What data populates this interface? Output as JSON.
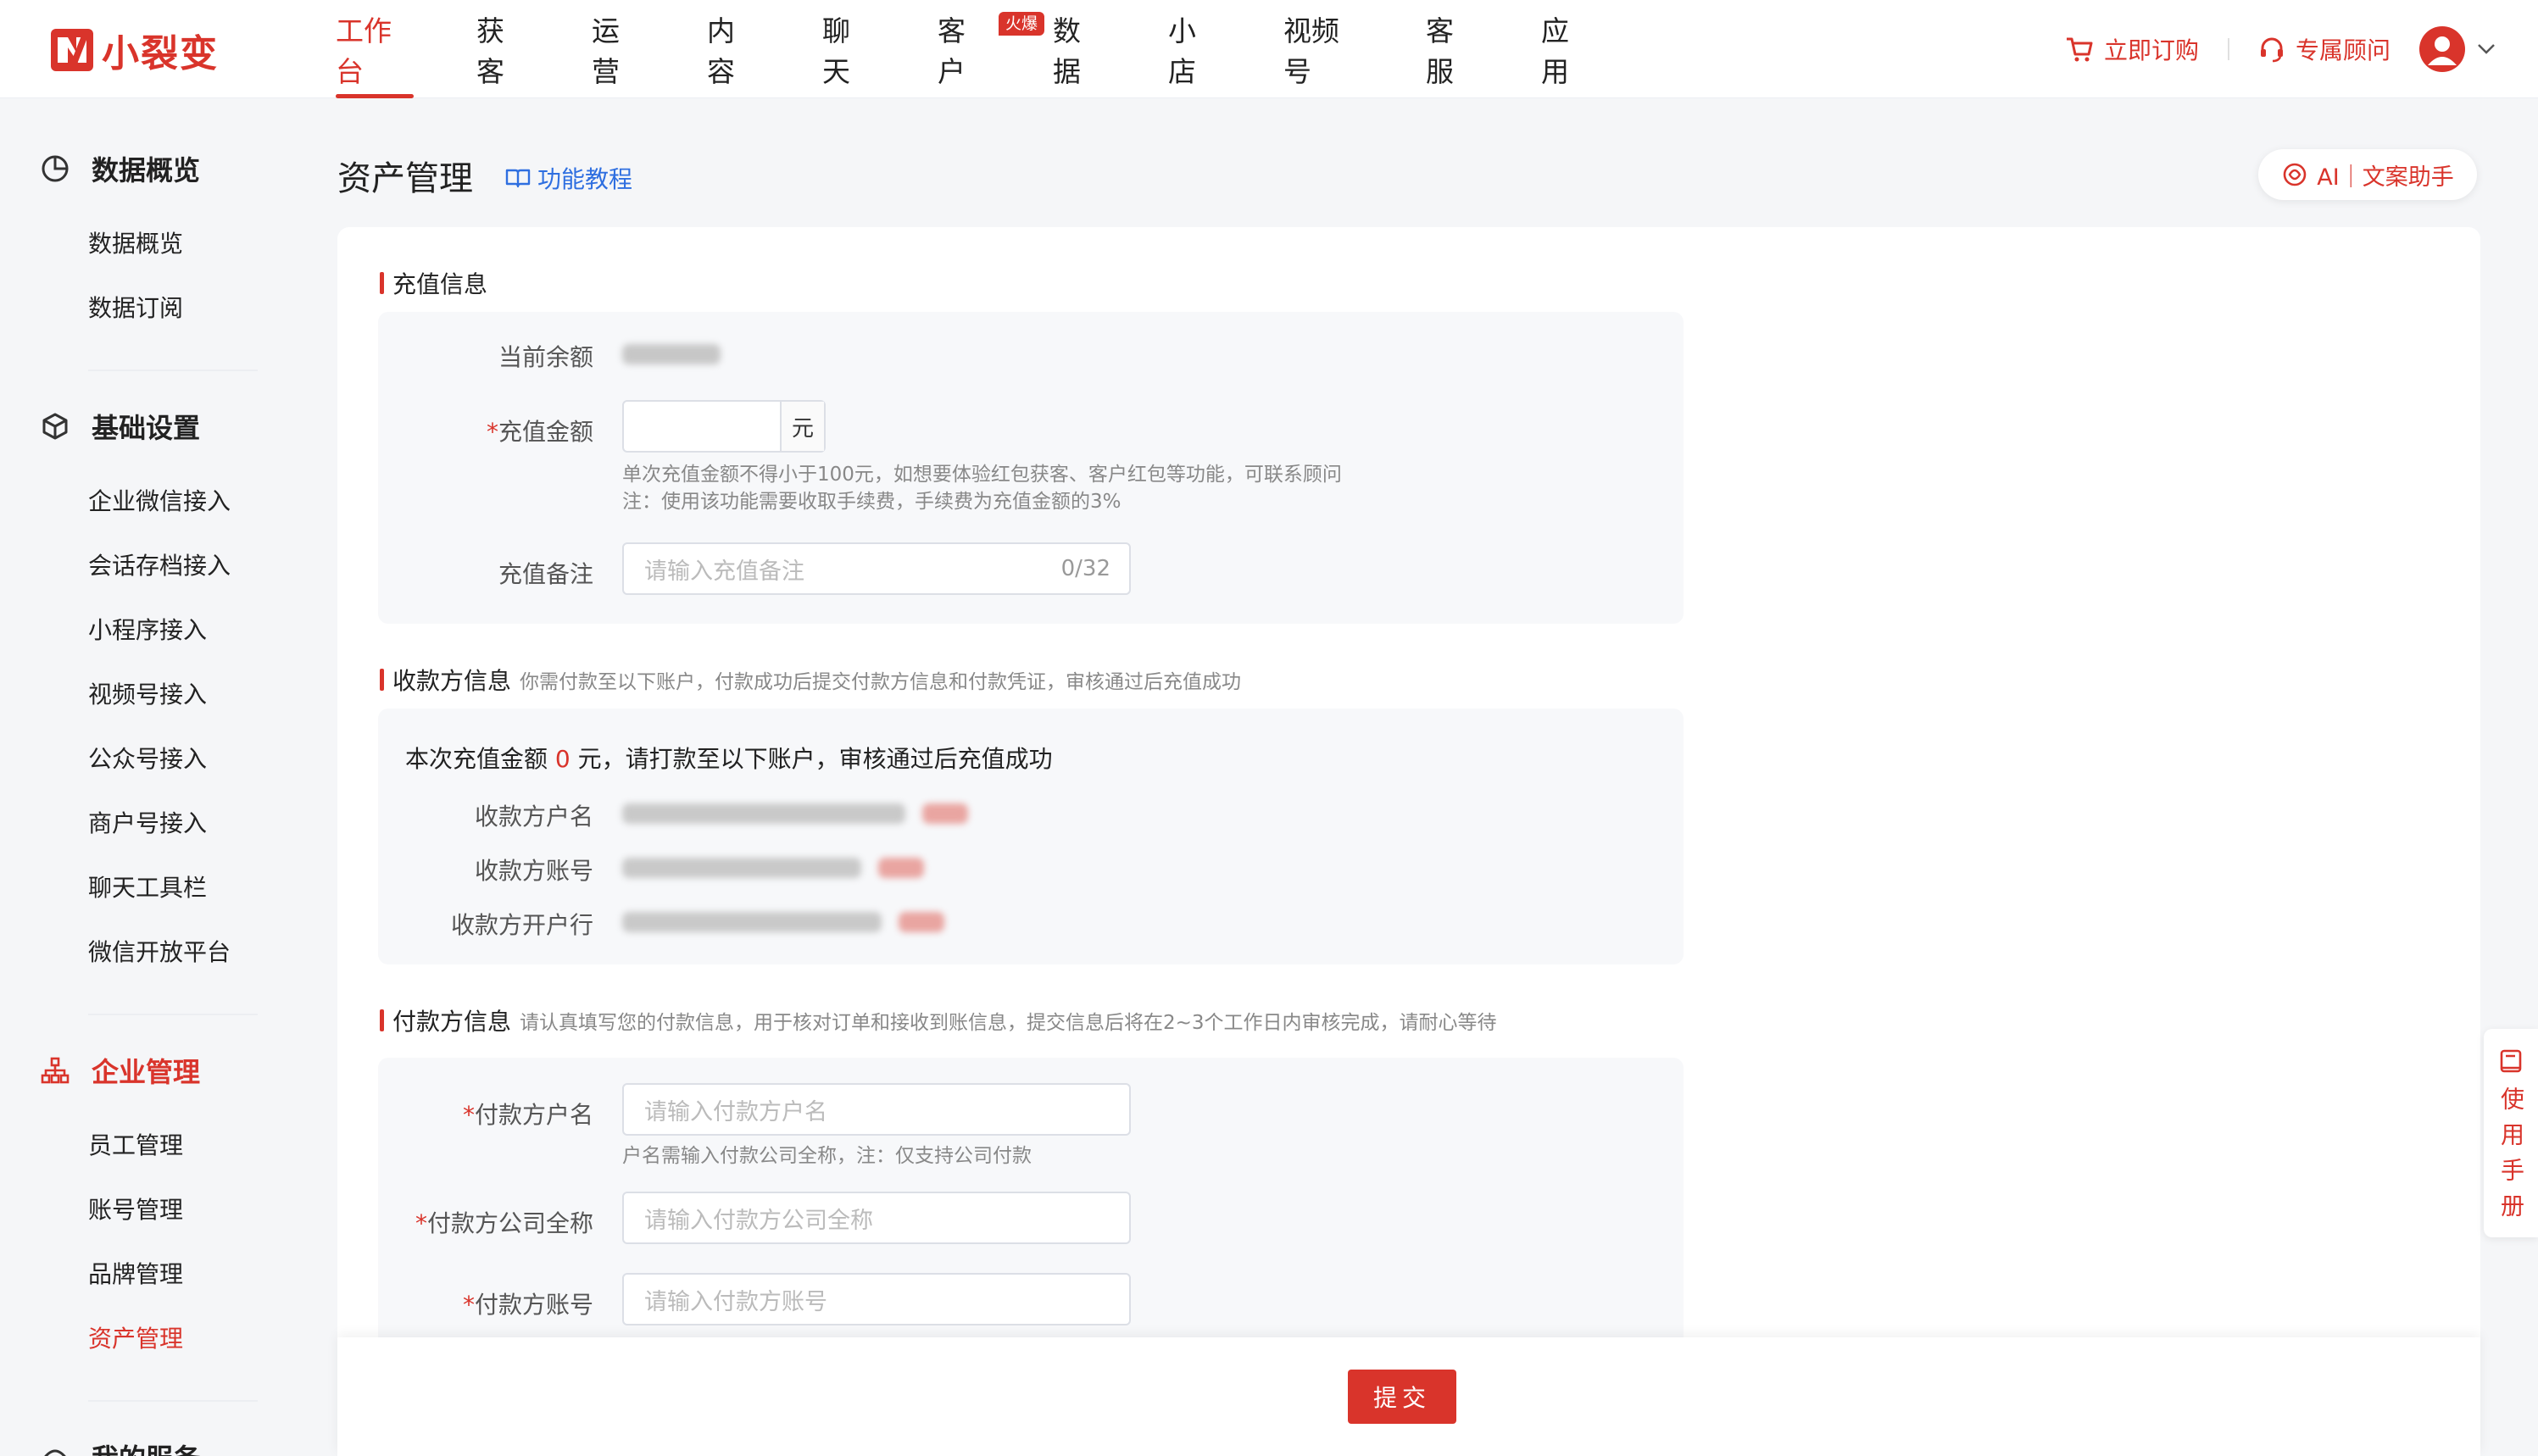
{
  "brand": {
    "name": "小裂变",
    "color": "#d9342b"
  },
  "nav": {
    "items": [
      "工作台",
      "获客",
      "运营",
      "内容",
      "聊天",
      "客户",
      "数据",
      "小店",
      "视频号",
      "客服",
      "应用"
    ],
    "active": "工作台",
    "hot_badge": "火爆"
  },
  "header_right": {
    "subscribe": "立即订购",
    "advisor": "专属顾问"
  },
  "sidebar": {
    "groups": [
      {
        "title": "数据概览",
        "icon": "pie-chart-icon",
        "items": [
          "数据概览",
          "数据订阅"
        ]
      },
      {
        "title": "基础设置",
        "icon": "cube-icon",
        "items": [
          "企业微信接入",
          "会话存档接入",
          "小程序接入",
          "视频号接入",
          "公众号接入",
          "商户号接入",
          "聊天工具栏",
          "微信开放平台"
        ]
      },
      {
        "title": "企业管理",
        "icon": "org-chart-icon",
        "items": [
          "员工管理",
          "账号管理",
          "品牌管理",
          "资产管理"
        ]
      },
      {
        "title": "我的服务",
        "icon": "service-icon",
        "items": []
      }
    ],
    "active_item": "资产管理"
  },
  "page": {
    "title": "资产管理",
    "tutorial_link": "功能教程",
    "ai_button": "AI｜文案助手"
  },
  "recharge": {
    "section_title": "充值信息",
    "balance_label": "当前余额",
    "amount_label": "充值金额",
    "amount_unit": "元",
    "amount_hint_1": "单次充值金额不得小于100元，如想要体验红包获客、客户红包等功能，可联系顾问",
    "amount_hint_2": "注：使用该功能需要收取手续费，手续费为充值金额的3%",
    "remark_label": "充值备注",
    "remark_placeholder": "请输入充值备注",
    "remark_counter": "0/32"
  },
  "payee": {
    "section_title": "收款方信息",
    "section_sub": "你需付款至以下账户，付款成功后提交付款方信息和付款凭证，审核通过后充值成功",
    "summary_prefix": "本次充值金额",
    "summary_amount": "0",
    "summary_suffix": "元，请打款至以下账户，审核通过后充值成功",
    "rows": [
      "收款方户名",
      "收款方账号",
      "收款方开户行"
    ]
  },
  "payer": {
    "section_title": "付款方信息",
    "section_sub": "请认真填写您的付款信息，用于核对订单和接收到账信息，提交信息后将在2~3个工作日内审核完成，请耐心等待",
    "name_label": "付款方户名",
    "name_placeholder": "请输入付款方户名",
    "name_hint": "户名需输入付款公司全称，注：仅支持公司付款",
    "company_label": "付款方公司全称",
    "company_placeholder": "请输入付款方公司全称",
    "account_label": "付款方账号",
    "account_placeholder": "请输入付款方账号"
  },
  "submit_label": "提交",
  "manual_label": "使用手册"
}
